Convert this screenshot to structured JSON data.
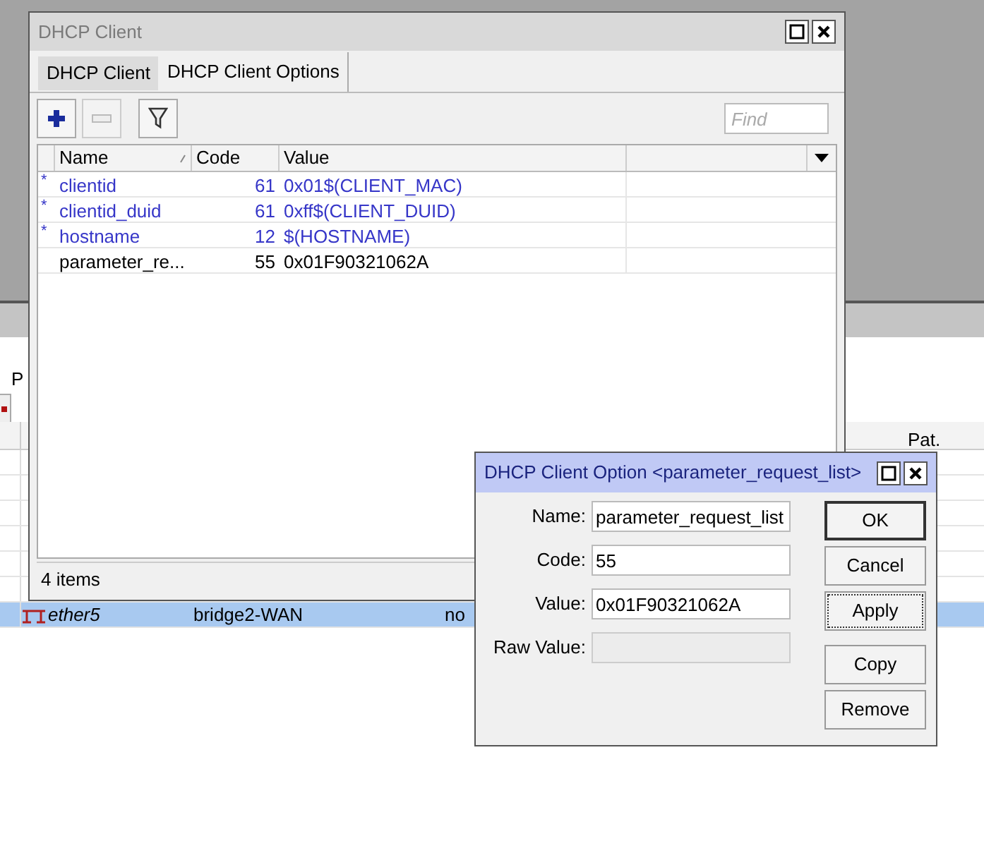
{
  "background_window": {
    "toolbar_label": "P",
    "header_text": "Pat.",
    "rows": [
      {
        "selected": false
      },
      {
        "selected": false
      },
      {
        "selected": false
      },
      {
        "selected": false
      },
      {
        "selected": false
      },
      {
        "selected": false
      },
      {
        "name": "ether5",
        "bridge": "bridge2-WAN",
        "column_3": "no",
        "selected": true
      }
    ]
  },
  "client_window": {
    "title": "DHCP Client",
    "tabs": [
      {
        "label": "DHCP Client",
        "selected": false
      },
      {
        "label": "DHCP Client Options",
        "selected": true
      }
    ],
    "search": {
      "placeholder": "Find"
    },
    "table": {
      "columns": [
        "Name",
        "Code",
        "Value"
      ],
      "rows": [
        {
          "marker": "*",
          "dynamic": true,
          "name": "clientid",
          "code": "61",
          "value": "0x01$(CLIENT_MAC)"
        },
        {
          "marker": "*",
          "dynamic": true,
          "name": "clientid_duid",
          "code": "61",
          "value": "0xff$(CLIENT_DUID)"
        },
        {
          "marker": "*",
          "dynamic": true,
          "name": "hostname",
          "code": "12",
          "value": "$(HOSTNAME)"
        },
        {
          "dynamic": false,
          "name": "parameter_re...",
          "code": "55",
          "value": "0x01F90321062A"
        }
      ]
    },
    "status": "4 items"
  },
  "dialog": {
    "title": "DHCP Client Option <parameter_request_list>",
    "fields": [
      {
        "label": "Name:",
        "value": "parameter_request_list",
        "disabled": false
      },
      {
        "label": "Code:",
        "value": "55",
        "disabled": false
      },
      {
        "label": "Value:",
        "value": "0x01F90321062A",
        "disabled": false
      },
      {
        "label": "Raw Value:",
        "disabled": true
      }
    ],
    "buttons": [
      {
        "label": "OK",
        "default": true,
        "focused": false
      },
      {
        "label": "Cancel",
        "default": false,
        "focused": false
      },
      {
        "label": "Apply",
        "default": false,
        "focused": true
      },
      {
        "label": "Copy",
        "default": false,
        "focused": false
      },
      {
        "label": "Remove",
        "default": false,
        "focused": false
      }
    ]
  }
}
